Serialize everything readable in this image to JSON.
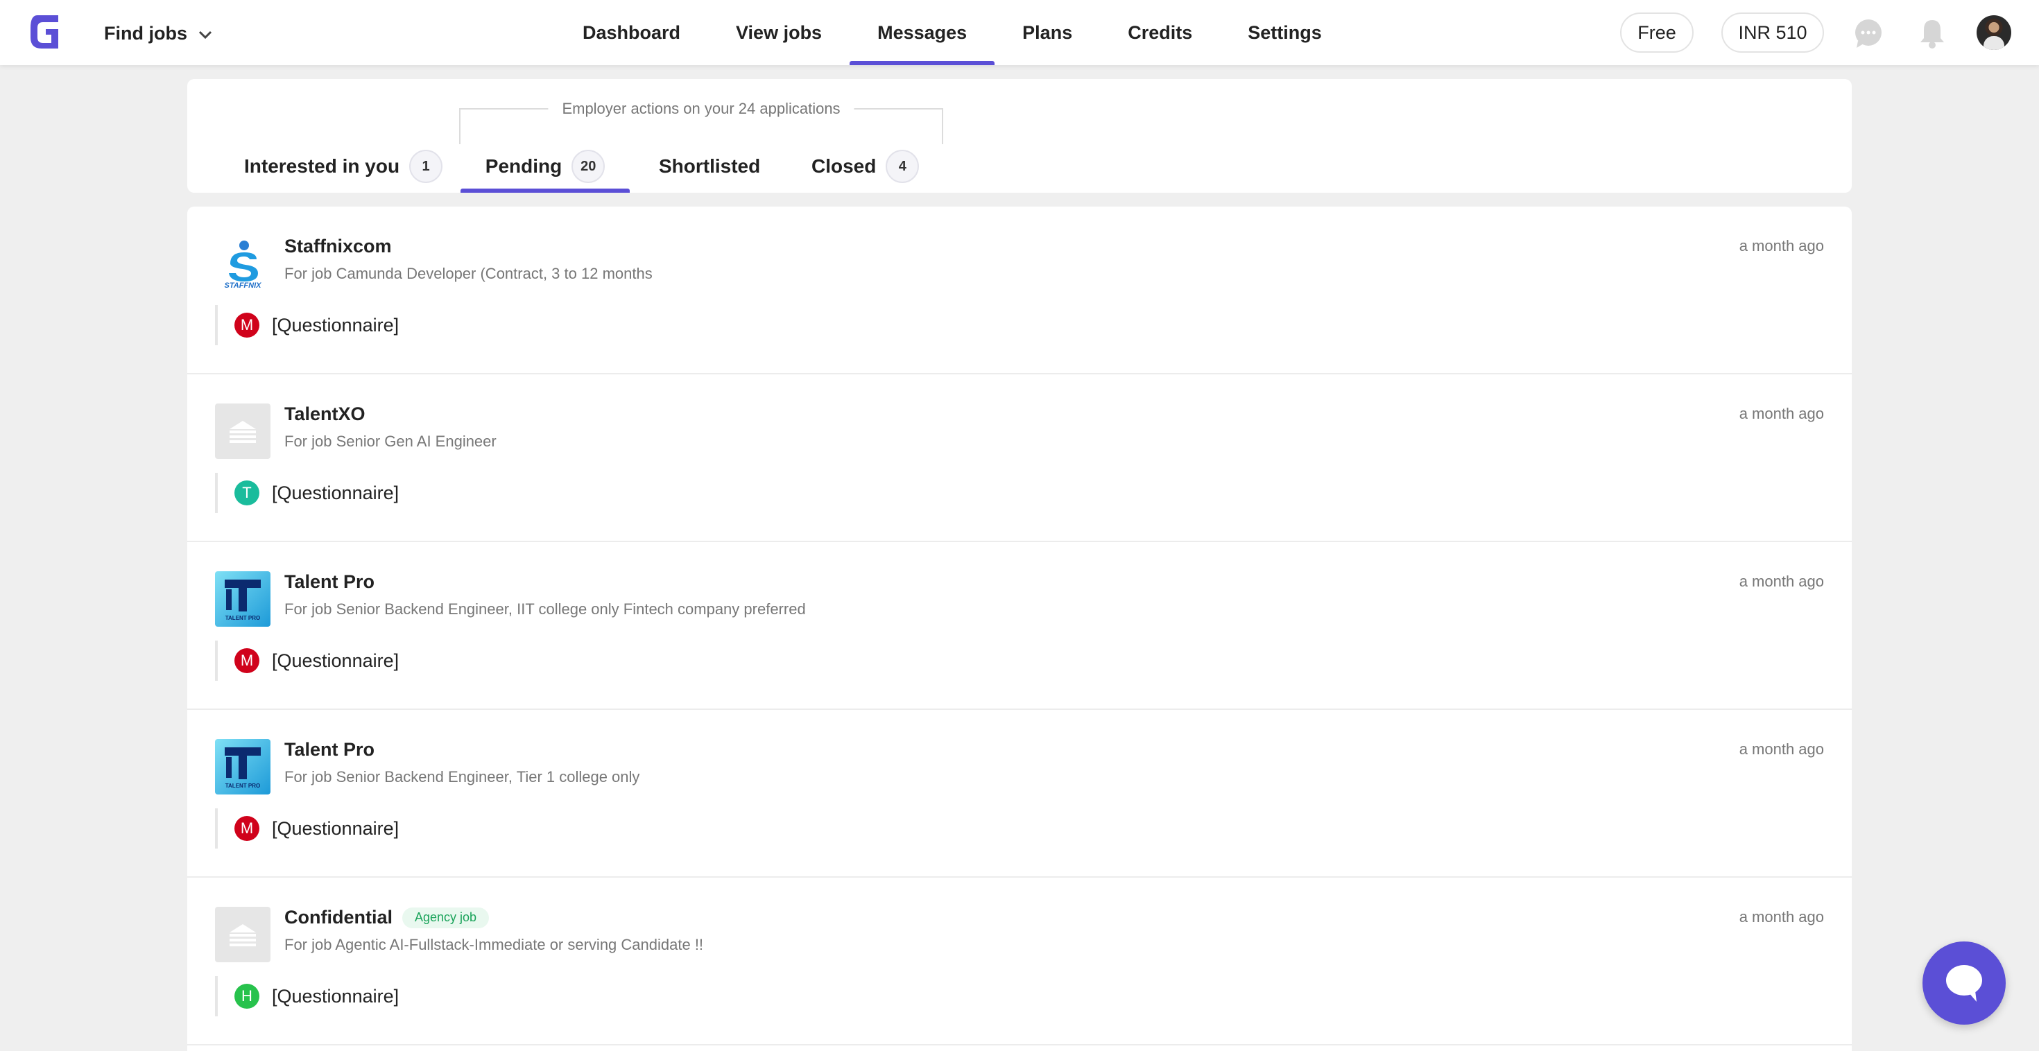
{
  "colors": {
    "accent": "#5b4fd6",
    "muted_text": "#777777",
    "agency_badge_bg": "#e9f8ef",
    "agency_badge_text": "#1aa35a"
  },
  "navbar": {
    "logo_icon": "brand-logo",
    "find_jobs_label": "Find jobs",
    "links": [
      {
        "label": "Dashboard",
        "active": false
      },
      {
        "label": "View jobs",
        "active": false
      },
      {
        "label": "Messages",
        "active": true
      },
      {
        "label": "Plans",
        "active": false
      },
      {
        "label": "Credits",
        "active": false
      },
      {
        "label": "Settings",
        "active": false
      }
    ],
    "plan_label": "Free",
    "credits_label": "INR 510",
    "icons": [
      "chat-bubble-icon",
      "bell-icon",
      "user-avatar"
    ]
  },
  "tabs": {
    "caption": "Employer actions on your 24 applications",
    "items": [
      {
        "label": "Interested in you",
        "count": "1",
        "active": false
      },
      {
        "label": "Pending",
        "count": "20",
        "active": true
      },
      {
        "label": "Shortlisted",
        "count": null,
        "active": false
      },
      {
        "label": "Closed",
        "count": "4",
        "active": false
      }
    ]
  },
  "messages": [
    {
      "company": "Staffnixcom",
      "badge": null,
      "job": "For job Camunda Developer (Contract, 3 to 12 months",
      "time": "a month ago",
      "sender_initial": "M",
      "sender_color": "#d0021b",
      "text": "[Questionnaire]",
      "logo": "staffnix-logo"
    },
    {
      "company": "TalentXO",
      "badge": null,
      "job": "For job Senior Gen AI Engineer",
      "time": "a month ago",
      "sender_initial": "T",
      "sender_color": "#1abc9c",
      "text": "[Questionnaire]",
      "logo": "building-placeholder"
    },
    {
      "company": "Talent Pro",
      "badge": null,
      "job": "For job Senior Backend Engineer, IIT college only Fintech company preferred",
      "time": "a month ago",
      "sender_initial": "M",
      "sender_color": "#d0021b",
      "text": "[Questionnaire]",
      "logo": "talent-pro-logo"
    },
    {
      "company": "Talent Pro",
      "badge": null,
      "job": "For job Senior Backend Engineer, Tier 1 college only",
      "time": "a month ago",
      "sender_initial": "M",
      "sender_color": "#d0021b",
      "text": "[Questionnaire]",
      "logo": "talent-pro-logo"
    },
    {
      "company": "Confidential",
      "badge": "Agency job",
      "job": "For job Agentic AI-Fullstack-Immediate or serving Candidate !!",
      "time": "a month ago",
      "sender_initial": "H",
      "sender_color": "#27c24c",
      "text": "[Questionnaire]",
      "logo": "building-placeholder"
    }
  ],
  "chat_widget_icon": "chat-widget-icon"
}
